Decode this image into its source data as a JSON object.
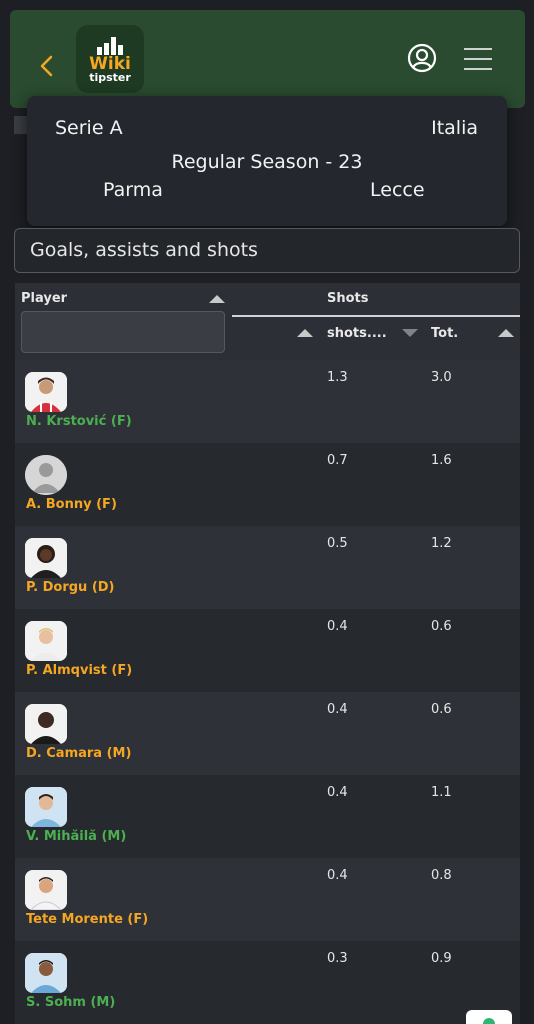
{
  "header": {
    "logo_word1": "Wiki",
    "logo_word2": "tipster"
  },
  "match": {
    "league": "Serie A",
    "country": "Italia",
    "round": "Regular Season - 23",
    "home_team": "Parma",
    "away_team": "Lecce"
  },
  "section": {
    "title": "Goals, assists and shots"
  },
  "table": {
    "player_header": "Player",
    "group_header": "Shots",
    "col1_header": "shots....",
    "col2_header": "Tot.",
    "filter_placeholder": "",
    "rows": [
      {
        "name": "N. Krstović (F)",
        "v1": "1.3",
        "v2": "3.0",
        "team_color": "#4caf50"
      },
      {
        "name": "A. Bonny (F)",
        "v1": "0.7",
        "v2": "1.6",
        "team_color": "#f5a623"
      },
      {
        "name": "P. Dorgu (D)",
        "v1": "0.5",
        "v2": "1.2",
        "team_color": "#f5a623"
      },
      {
        "name": "P. Almqvist (F)",
        "v1": "0.4",
        "v2": "0.6",
        "team_color": "#f5a623"
      },
      {
        "name": "D. Camara (M)",
        "v1": "0.4",
        "v2": "0.6",
        "team_color": "#f5a623"
      },
      {
        "name": "V. Mihăilă (M)",
        "v1": "0.4",
        "v2": "1.1",
        "team_color": "#4caf50"
      },
      {
        "name": "Tete Morente (F)",
        "v1": "0.4",
        "v2": "0.8",
        "team_color": "#f5a623"
      },
      {
        "name": "S. Sohm (M)",
        "v1": "0.3",
        "v2": "0.9",
        "team_color": "#4caf50"
      }
    ]
  },
  "colors": {
    "topbar": "#2a4b2f",
    "accent_orange": "#f5a623",
    "accent_green": "#4caf50",
    "background": "#1d1f24"
  }
}
